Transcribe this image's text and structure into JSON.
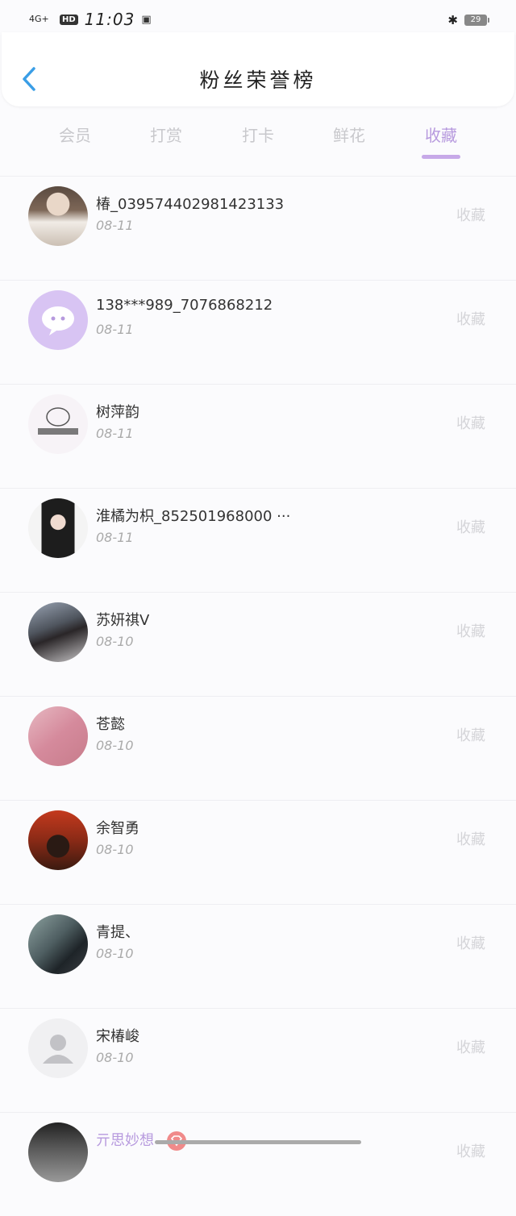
{
  "status_bar": {
    "signal": "4G+",
    "hd": "HD",
    "time": "11:03",
    "battery": "29"
  },
  "header": {
    "title": "粉丝荣誉榜"
  },
  "tabs": [
    {
      "label": "会员"
    },
    {
      "label": "打赏"
    },
    {
      "label": "打卡"
    },
    {
      "label": "鲜花"
    },
    {
      "label": "收藏"
    }
  ],
  "active_tab": "收藏",
  "rows": [
    {
      "name": "椿_03957440298142313​3",
      "date": "08-11",
      "action": "收藏"
    },
    {
      "name": "138***989_7076868212",
      "date": "08-11",
      "action": "收藏"
    },
    {
      "name": "树萍韵",
      "date": "08-11",
      "action": "收藏"
    },
    {
      "name": "淮橘为枳_852501968000 ···",
      "date": "08-11",
      "action": "收藏"
    },
    {
      "name": "苏妍祺V",
      "date": "08-10",
      "action": "收藏"
    },
    {
      "name": "苍懿",
      "date": "08-10",
      "action": "收藏"
    },
    {
      "name": "余智勇",
      "date": "08-10",
      "action": "收藏"
    },
    {
      "name": "青提、",
      "date": "08-10",
      "action": "收藏"
    },
    {
      "name": "宋椿峻",
      "date": "08-10",
      "action": "收藏"
    },
    {
      "name": "亓思妙想",
      "date": "",
      "action": "收藏"
    }
  ],
  "colors": {
    "accent": "#b79ade",
    "back_arrow": "#3a9ee6",
    "vip_name": "#b79ade"
  }
}
